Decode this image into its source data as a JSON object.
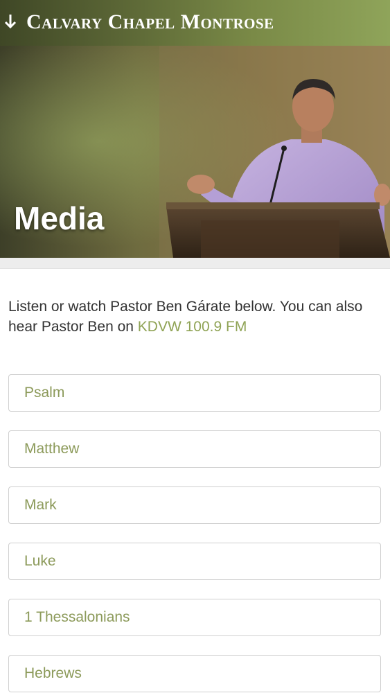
{
  "header": {
    "menu_icon": "down-arrow-icon",
    "site_title": "Calvary Chapel Montrose"
  },
  "hero": {
    "title": "Media"
  },
  "intro": {
    "text": "Listen or watch Pastor Ben Gárate below. You can also hear Pastor Ben on ",
    "link_text": "KDVW 100.9 FM"
  },
  "series_list": [
    {
      "label": "Psalm"
    },
    {
      "label": "Matthew"
    },
    {
      "label": "Mark"
    },
    {
      "label": "Luke"
    },
    {
      "label": "1 Thessalonians"
    },
    {
      "label": "Hebrews"
    }
  ],
  "colors": {
    "accent_green": "#8fa355",
    "list_text": "#8c9a5a",
    "body_text": "#333333"
  }
}
